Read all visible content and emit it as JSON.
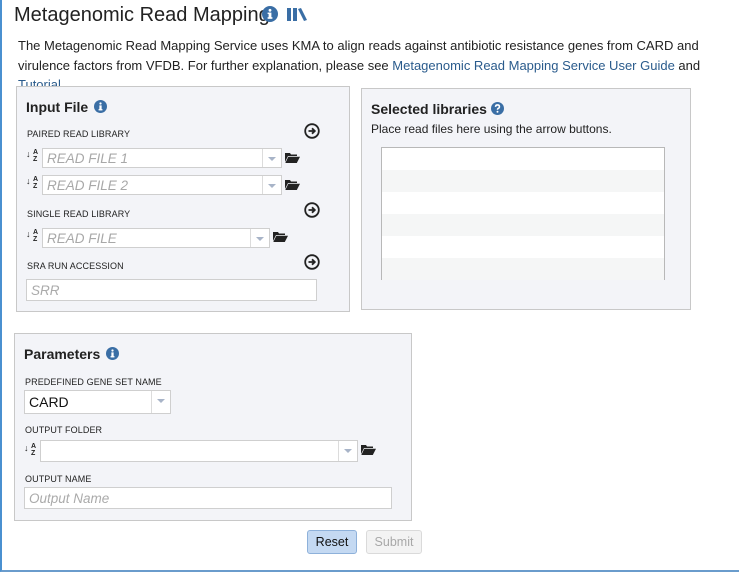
{
  "header": {
    "title": "Metagenomic Read Mapping",
    "icons": [
      "info-icon",
      "library-icon"
    ]
  },
  "description": {
    "text_before": "The Metagenomic Read Mapping Service uses KMA to align reads against antibiotic resistance genes from CARD and virulence factors from VFDB. For further explanation, please see ",
    "guide_link": "Metagenomic Read Mapping Service User Guide",
    "text_between": " and ",
    "tutorial_link": "Tutorial",
    "text_after": "."
  },
  "input_file": {
    "title": "Input File",
    "paired_label": "PAIRED READ LIBRARY",
    "read_file_1_placeholder": "READ FILE 1",
    "read_file_2_placeholder": "READ FILE 2",
    "single_label": "SINGLE READ LIBRARY",
    "read_file_placeholder": "READ FILE",
    "sra_label": "SRA RUN ACCESSION",
    "sra_placeholder": "SRR"
  },
  "selected_libraries": {
    "title": "Selected libraries",
    "hint": "Place read files here using the arrow buttons.",
    "rows": [
      "",
      "",
      "",
      "",
      "",
      ""
    ]
  },
  "parameters": {
    "title": "Parameters",
    "gene_set_label": "PREDEFINED GENE SET NAME",
    "gene_set_value": "CARD",
    "output_folder_label": "OUTPUT FOLDER",
    "output_folder_value": "",
    "output_name_label": "OUTPUT NAME",
    "output_name_placeholder": "Output Name"
  },
  "actions": {
    "reset_label": "Reset",
    "submit_label": "Submit"
  },
  "colors": {
    "link": "#2a5b8c",
    "info_icon": "#3a6ea5",
    "reset_bg": "#c4d9f2"
  }
}
